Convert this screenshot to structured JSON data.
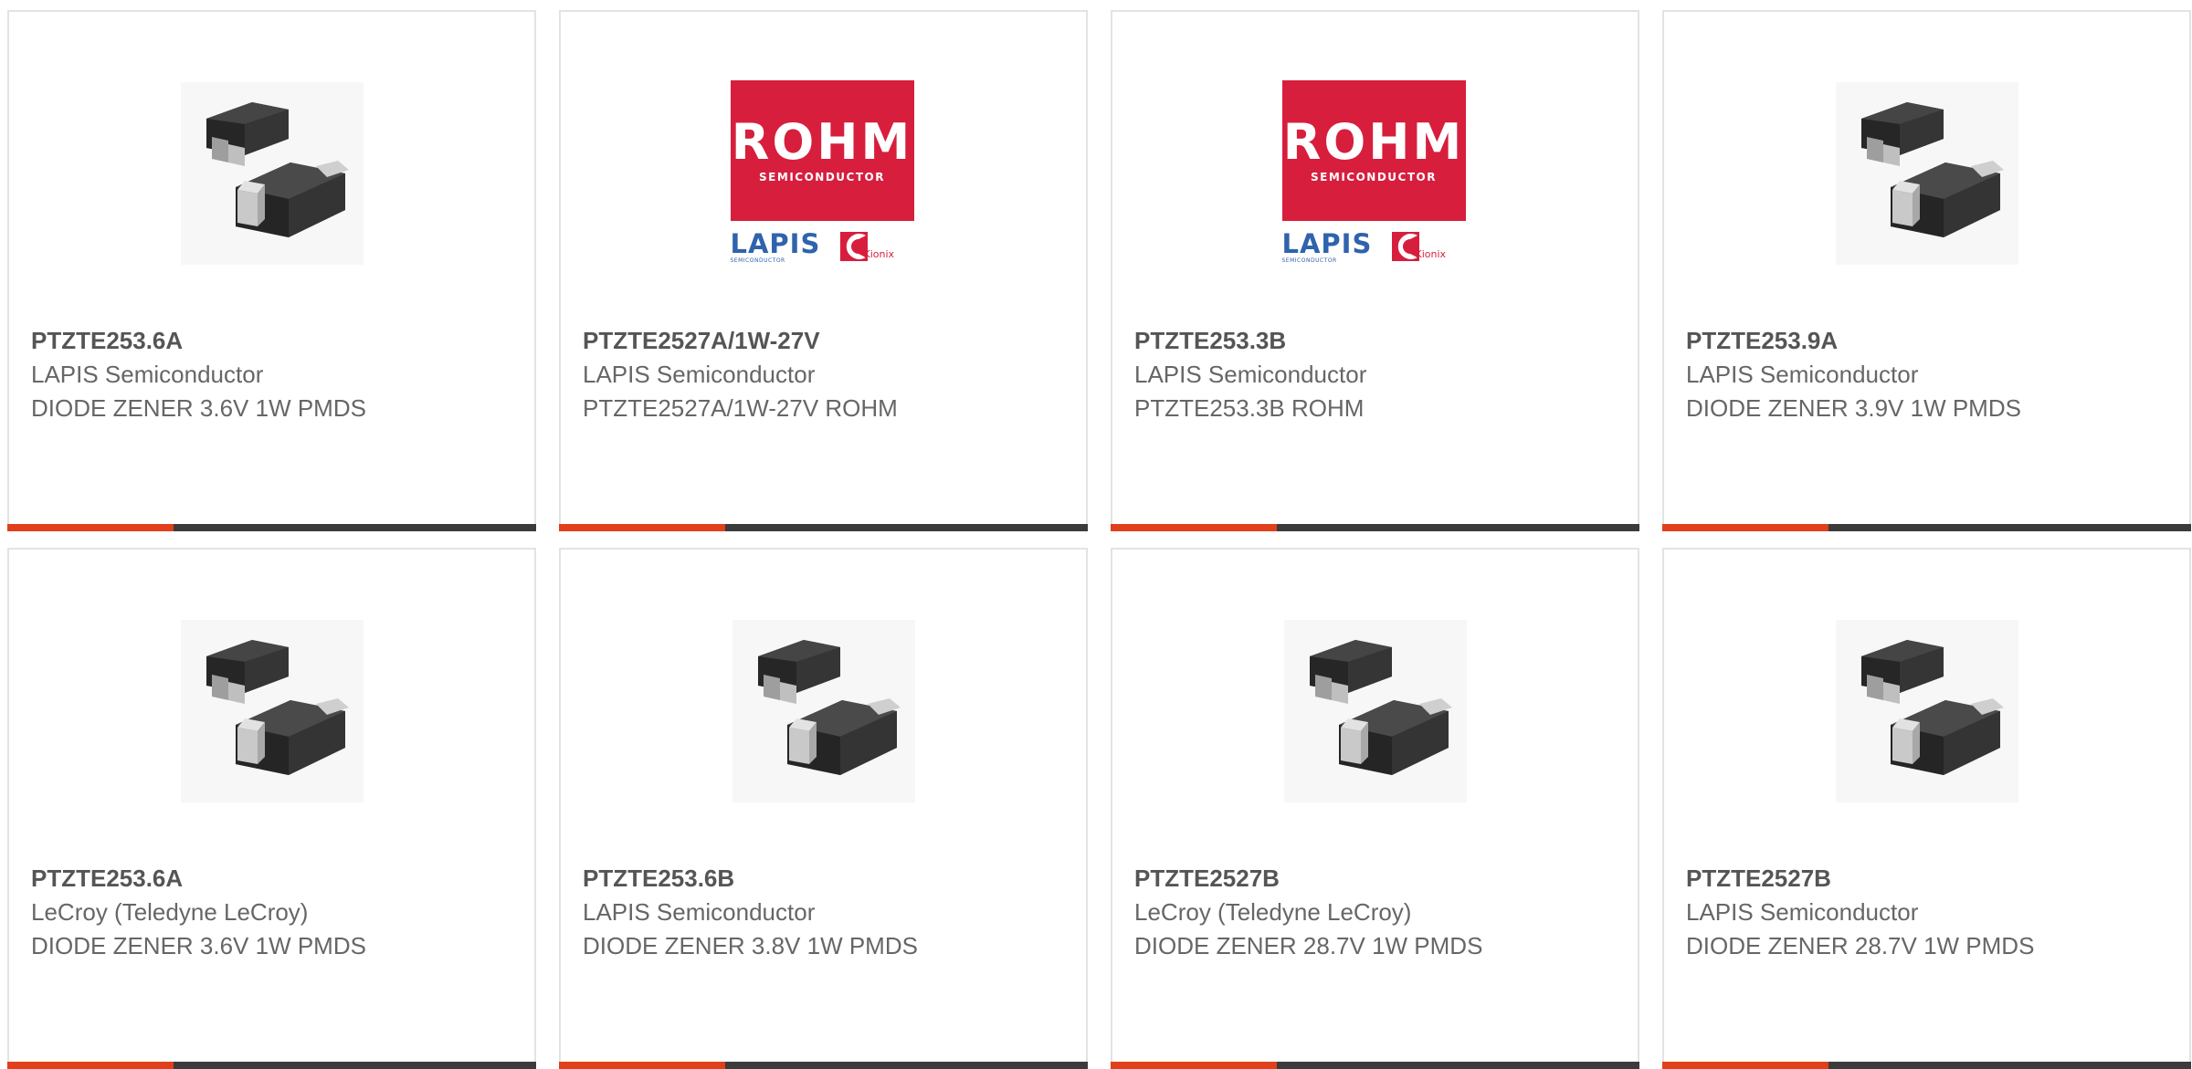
{
  "products": [
    {
      "part": "PTZTE253.6A",
      "manufacturer": "LAPIS Semiconductor",
      "description": "DIODE ZENER 3.6V 1W PMDS",
      "image": "diode-package"
    },
    {
      "part": "PTZTE2527A/1W-27V",
      "manufacturer": "LAPIS Semiconductor",
      "description": "PTZTE2527A/1W-27V ROHM",
      "image": "rohm-logo"
    },
    {
      "part": "PTZTE253.3B",
      "manufacturer": "LAPIS Semiconductor",
      "description": "PTZTE253.3B ROHM",
      "image": "rohm-logo"
    },
    {
      "part": "PTZTE253.9A",
      "manufacturer": "LAPIS Semiconductor",
      "description": "DIODE ZENER 3.9V 1W PMDS",
      "image": "diode-package"
    },
    {
      "part": "PTZTE253.6A",
      "manufacturer": "LeCroy (Teledyne LeCroy)",
      "description": "DIODE ZENER 3.6V 1W PMDS",
      "image": "diode-package"
    },
    {
      "part": "PTZTE253.6B",
      "manufacturer": "LAPIS Semiconductor",
      "description": "DIODE ZENER 3.8V 1W PMDS",
      "image": "diode-package"
    },
    {
      "part": "PTZTE2527B",
      "manufacturer": "LeCroy (Teledyne LeCroy)",
      "description": "DIODE ZENER 28.7V 1W PMDS",
      "image": "diode-package"
    },
    {
      "part": "PTZTE2527B",
      "manufacturer": "LAPIS Semiconductor",
      "description": "DIODE ZENER 28.7V 1W PMDS",
      "image": "diode-package"
    }
  ],
  "logo": {
    "brand": "ROHM",
    "brand_sub": "SEMICONDUCTOR",
    "lapis": "LAPIS",
    "lapis_sub": "SEMICONDUCTOR",
    "kionix": "Kionix"
  },
  "colors": {
    "accent": "#e0401c",
    "bar": "#3b3b3b",
    "rohm_red": "#d71e3d",
    "lapis_blue": "#2f63ad"
  }
}
